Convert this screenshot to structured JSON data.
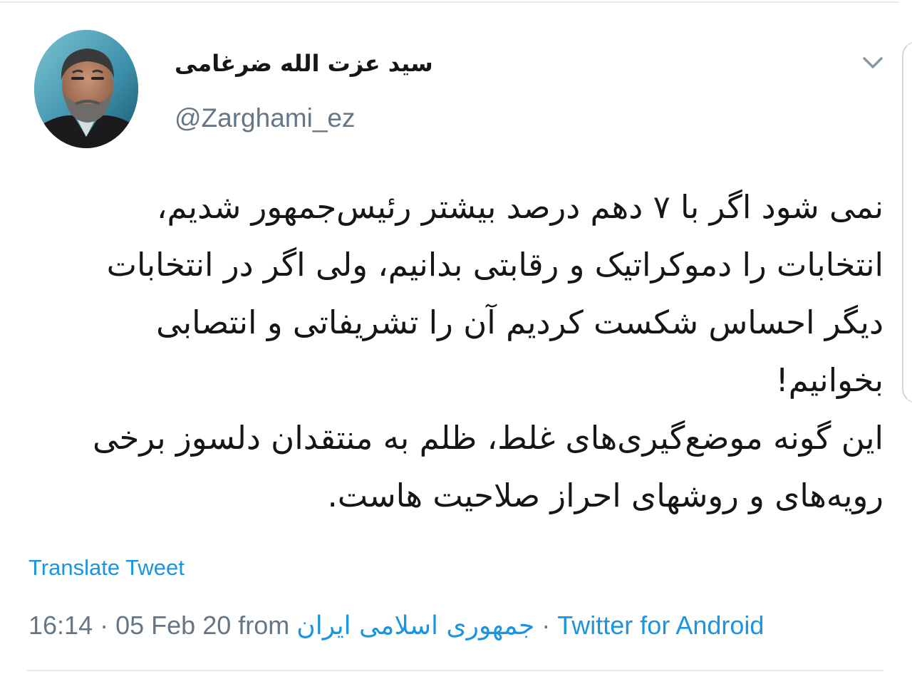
{
  "tweet": {
    "author": {
      "display_name": "سید عزت الله ضرغامی",
      "handle": "@Zarghami_ez"
    },
    "text_lines": [
      "نمی شود اگر با ۷ دهم درصد بیشتر رئیس‌جمهور شدیم،",
      "انتخابات را دموکراتیک و رقابتی بدانیم، ولی اگر در انتخابات",
      "دیگر احساس شکست کردیم آن را تشریفاتی و انتصابی",
      "بخوانیم!",
      "این گونه موضع‌گیری‌های غلط، ظلم به منتقدان دلسوز برخی",
      "رویه‌های و روشهای احراز صلاحیت هاست."
    ],
    "translate_label": "Translate Tweet",
    "meta": {
      "time": "16:14",
      "separator": "·",
      "date": "05 Feb 20",
      "from_label": "from",
      "location": "جمهوری اسلامی ایران",
      "source": "Twitter for Android"
    }
  },
  "icons": {
    "tweet_menu": "chevron-down-icon"
  },
  "colors": {
    "text": "#14171a",
    "secondary": "#657786",
    "link": "#1b95e0",
    "divider": "#e6ecf0"
  }
}
